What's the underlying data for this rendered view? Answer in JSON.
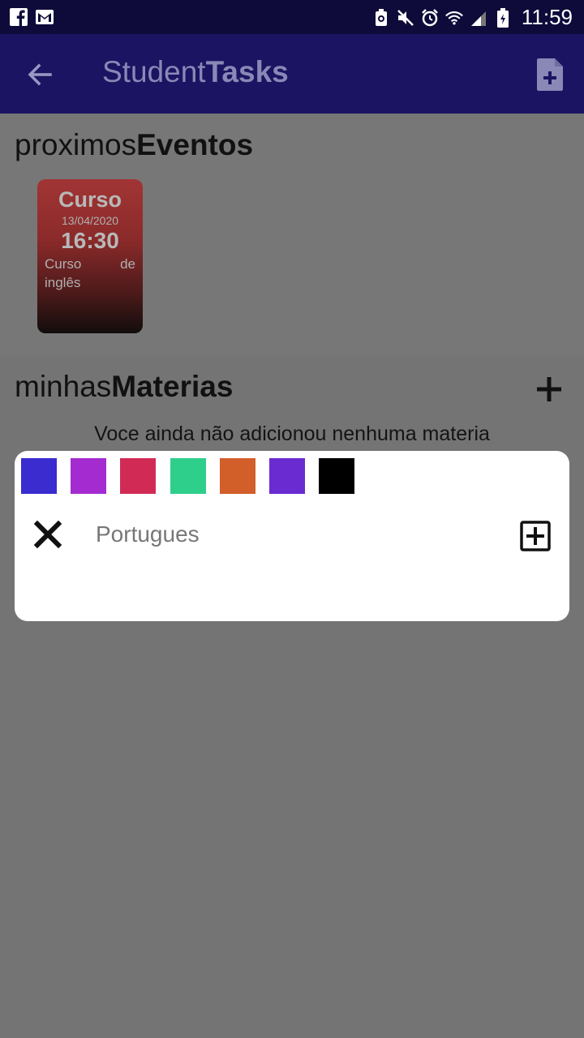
{
  "status_bar": {
    "time": "11:59"
  },
  "app_bar": {
    "title_light": "Student",
    "title_bold": "Tasks"
  },
  "events": {
    "title_light": "proximos",
    "title_bold": "Eventos",
    "items": [
      {
        "type": "Curso",
        "date": "13/04/2020",
        "time": "16:30",
        "description": "Curso de inglês"
      }
    ]
  },
  "materias": {
    "title_light": "minhas",
    "title_bold": "Materias",
    "empty_message": "Voce ainda não adicionou nenhuma materia"
  },
  "dialog": {
    "colors": [
      "#3a2ccf",
      "#a42bd0",
      "#d12b55",
      "#2ecf8b",
      "#d25e2a",
      "#6a2bd0",
      "#000000"
    ],
    "input_placeholder": "Portugues",
    "input_value": ""
  }
}
